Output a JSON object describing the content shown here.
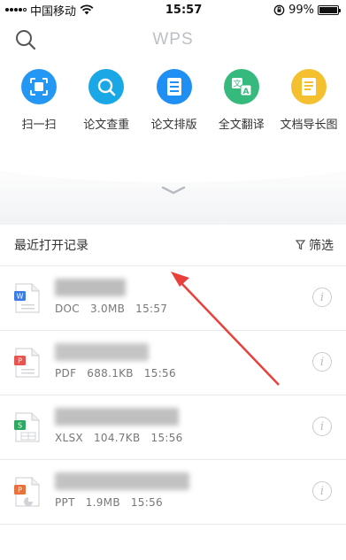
{
  "status_bar": {
    "carrier": "中国移动",
    "time": "15:57",
    "battery_percent": "99%",
    "battery_level": 0.99
  },
  "header": {
    "logo_text": "WPS",
    "search_icon": "search-icon"
  },
  "tools": [
    {
      "label": "扫一扫",
      "icon": "scan-icon",
      "color": "#2497f5"
    },
    {
      "label": "论文查重",
      "icon": "paper-check-icon",
      "color": "#1aa7e6"
    },
    {
      "label": "论文排版",
      "icon": "paper-layout-icon",
      "color": "#1f8ff3"
    },
    {
      "label": "全文翻译",
      "icon": "translate-icon",
      "color": "#35b97c"
    },
    {
      "label": "文档导长图",
      "icon": "doc-to-image-icon",
      "color": "#f5c030"
    }
  ],
  "recent": {
    "title": "最近打开记录",
    "filter_label": "筛选",
    "files": [
      {
        "type": "DOC",
        "size": "3.0MB",
        "time": "15:57",
        "icon": "word-file-icon",
        "color": "#3d7ce8"
      },
      {
        "type": "PDF",
        "size": "688.1KB",
        "time": "15:56",
        "icon": "pdf-file-icon",
        "color": "#e85550"
      },
      {
        "type": "XLSX",
        "size": "104.7KB",
        "time": "15:56",
        "icon": "excel-file-icon",
        "color": "#2fa864"
      },
      {
        "type": "PPT",
        "size": "1.9MB",
        "time": "15:56",
        "icon": "ppt-file-icon",
        "color": "#e8713d"
      }
    ]
  }
}
